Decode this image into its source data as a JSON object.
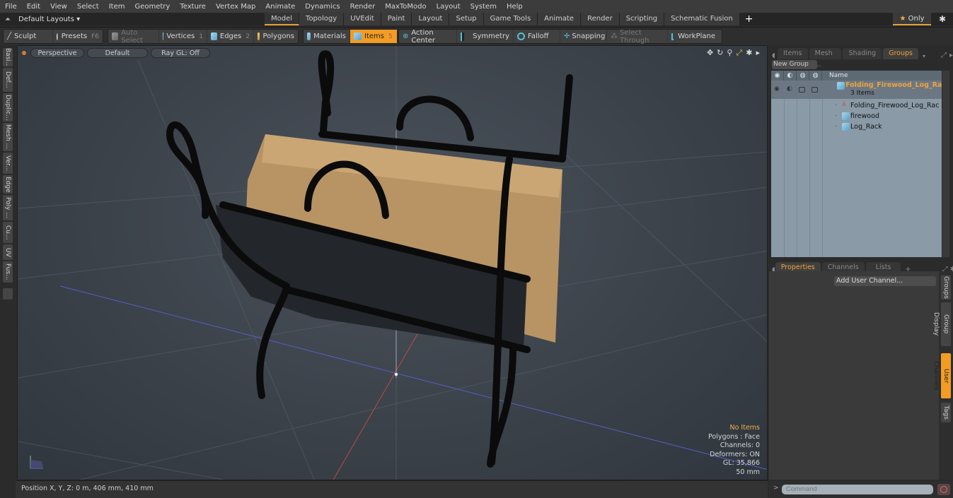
{
  "menu": [
    "File",
    "Edit",
    "View",
    "Select",
    "Item",
    "Geometry",
    "Texture",
    "Vertex Map",
    "Animate",
    "Dynamics",
    "Render",
    "MaxToModo",
    "Layout",
    "System",
    "Help"
  ],
  "layout_bar": {
    "default_layouts": "Default Layouts ▾",
    "tabs": [
      "Model",
      "Topology",
      "UVEdit",
      "Paint",
      "Layout",
      "Setup",
      "Game Tools",
      "Animate",
      "Render",
      "Scripting",
      "Schematic Fusion"
    ],
    "active_tab": "Model",
    "add_tab": "+",
    "only_label": "Only",
    "star": "★",
    "gear": "✱"
  },
  "toolbar": {
    "sculpt": "Sculpt",
    "presets": "Presets",
    "presets_key": "F6",
    "auto_select": "Auto Select",
    "vertices": "Vertices",
    "vertices_key": "1",
    "edges": "Edges",
    "edges_key": "2",
    "polygons": "Polygons",
    "materials": "Materials",
    "items": "Items",
    "items_key": "5",
    "action_center": "Action Center",
    "symmetry": "Symmetry",
    "falloff": "Falloff",
    "snapping": "Snapping",
    "select_through": "Select Through",
    "workplane": "WorkPlane"
  },
  "left_tabs": [
    "Basi...",
    "Def...",
    "Duplic...",
    "Mesh ...",
    "Ver...",
    "Edge",
    "Poly ...",
    "Cu...",
    "UV",
    "Fus..."
  ],
  "viewport": {
    "view_mode": "Perspective",
    "shading": "Default",
    "raygl": "Ray GL: Off",
    "stats": {
      "selection": "No Items",
      "polygons": "Polygons : Face",
      "channels": "Channels: 0",
      "deformers": "Deformers: ON",
      "gl": "GL: 35,866",
      "scale": "50 mm"
    }
  },
  "statusbar": {
    "position": "Position X, Y, Z:   0 m, 406 mm, 410 mm"
  },
  "groups_panel": {
    "tabs": [
      "Items",
      "Mesh ...",
      "Shading",
      "Groups"
    ],
    "active_tab": "Groups",
    "new_group": "New Group",
    "name_header": "Name",
    "group": {
      "name": "Folding_Firewood_Log_Ra...",
      "count": "3 Items",
      "children": [
        "Folding_Firewood_Log_Rac ...",
        "firewood",
        "Log_Rack"
      ]
    }
  },
  "properties_panel": {
    "tabs": [
      "Properties",
      "Channels",
      "Lists"
    ],
    "active_tab": "Properties",
    "add_tab": "+",
    "add_user_channel": "Add User Channel...",
    "side_tabs": [
      "Groups",
      "Group Display",
      "User Channels",
      "Tags"
    ],
    "active_side_tab": "User Channels"
  },
  "command": {
    "prompt": ">",
    "placeholder": "Command"
  }
}
